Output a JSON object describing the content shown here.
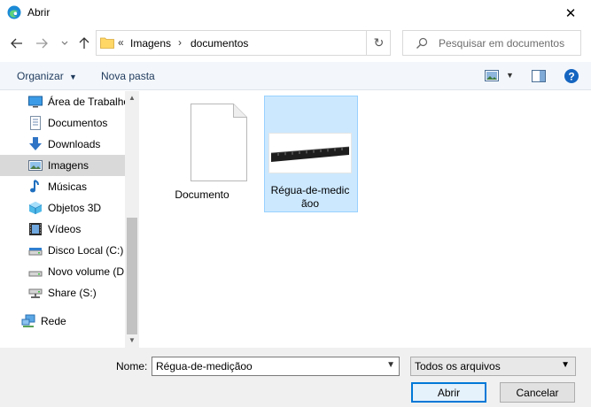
{
  "window": {
    "title": "Abrir"
  },
  "address": {
    "overflow_label": "«",
    "segments": [
      "Imagens",
      "documentos"
    ]
  },
  "search": {
    "placeholder": "Pesquisar em documentos"
  },
  "toolbar": {
    "organize_label": "Organizar",
    "new_folder_label": "Nova pasta"
  },
  "sidebar": {
    "items": [
      {
        "label": "Área de Trabalho",
        "icon": "desktop-icon"
      },
      {
        "label": "Documentos",
        "icon": "documents-icon"
      },
      {
        "label": "Downloads",
        "icon": "download-arrow-icon"
      },
      {
        "label": "Imagens",
        "icon": "pictures-icon",
        "selected": true
      },
      {
        "label": "Músicas",
        "icon": "music-note-icon"
      },
      {
        "label": "Objetos 3D",
        "icon": "cube-3d-icon"
      },
      {
        "label": "Vídeos",
        "icon": "film-icon"
      },
      {
        "label": "Disco Local (C:)",
        "icon": "drive-icon"
      },
      {
        "label": "Novo volume (D:)",
        "icon": "drive-icon"
      },
      {
        "label": "Share (S:)",
        "icon": "network-drive-icon"
      },
      {
        "label": "Rede",
        "icon": "network-icon"
      }
    ]
  },
  "files": [
    {
      "name": "Documento",
      "type": "document",
      "icon": "blank-document-icon"
    },
    {
      "name_line1": "Régua-de-medic",
      "name_line2": "ãoo",
      "type": "image",
      "selected": true,
      "icon": "ruler-photo-thumbnail"
    }
  ],
  "footer": {
    "name_label": "Nome:",
    "name_value": "Régua-de-mediçãoo",
    "filter_value": "Todos os arquivos",
    "open_label": "Abrir",
    "cancel_label": "Cancelar"
  },
  "colors": {
    "accent": "#0078d7",
    "selection": "#cce8ff",
    "toolbar_bg": "#f3f7fc",
    "footer_bg": "#f0f0f0"
  }
}
